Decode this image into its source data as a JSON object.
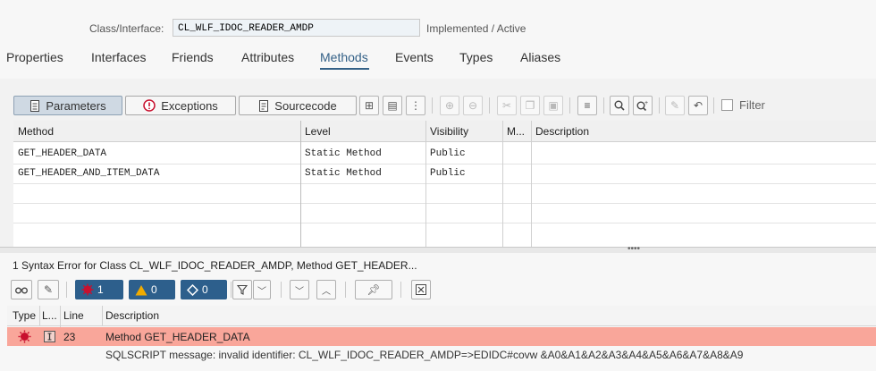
{
  "header": {
    "class_label": "Class/Interface:",
    "class_value": "CL_WLF_IDOC_READER_AMDP",
    "status": "Implemented / Active"
  },
  "tabs": [
    "Properties",
    "Interfaces",
    "Friends",
    "Attributes",
    "Methods",
    "Events",
    "Types",
    "Aliases"
  ],
  "active_tab": "Methods",
  "toolbar": {
    "parameters_label": "Parameters",
    "exceptions_label": "Exceptions",
    "sourcecode_label": "Sourcecode",
    "filter_label": "Filter"
  },
  "methods_table": {
    "columns": [
      "Method",
      "Level",
      "Visibility",
      "M...",
      "Description"
    ],
    "rows": [
      {
        "method": "GET_HEADER_DATA",
        "level": "Static Method",
        "visibility": "Public"
      },
      {
        "method": "GET_HEADER_AND_ITEM_DATA",
        "level": "Static Method",
        "visibility": "Public"
      }
    ]
  },
  "errors": {
    "title": "1 Syntax Error for Class CL_WLF_IDOC_READER_AMDP, Method GET_HEADER...",
    "count_error": "1",
    "count_warning": "0",
    "count_info": "0",
    "columns": [
      "Type",
      "L...",
      "Line",
      "Description"
    ],
    "rows": [
      {
        "line": "23",
        "description": "Method GET_HEADER_DATA"
      }
    ],
    "message": "SQLSCRIPT message: invalid identifier: CL_WLF_IDOC_READER_AMDP=>EDIDC#covw  &A0&A1&A2&A3&A4&A5&A6&A7&A8&A9"
  },
  "colors": {
    "accent": "#346187",
    "error_row": "#f9a69a",
    "error_icon": "#c8102e",
    "count_button": "#2d5f8c"
  }
}
